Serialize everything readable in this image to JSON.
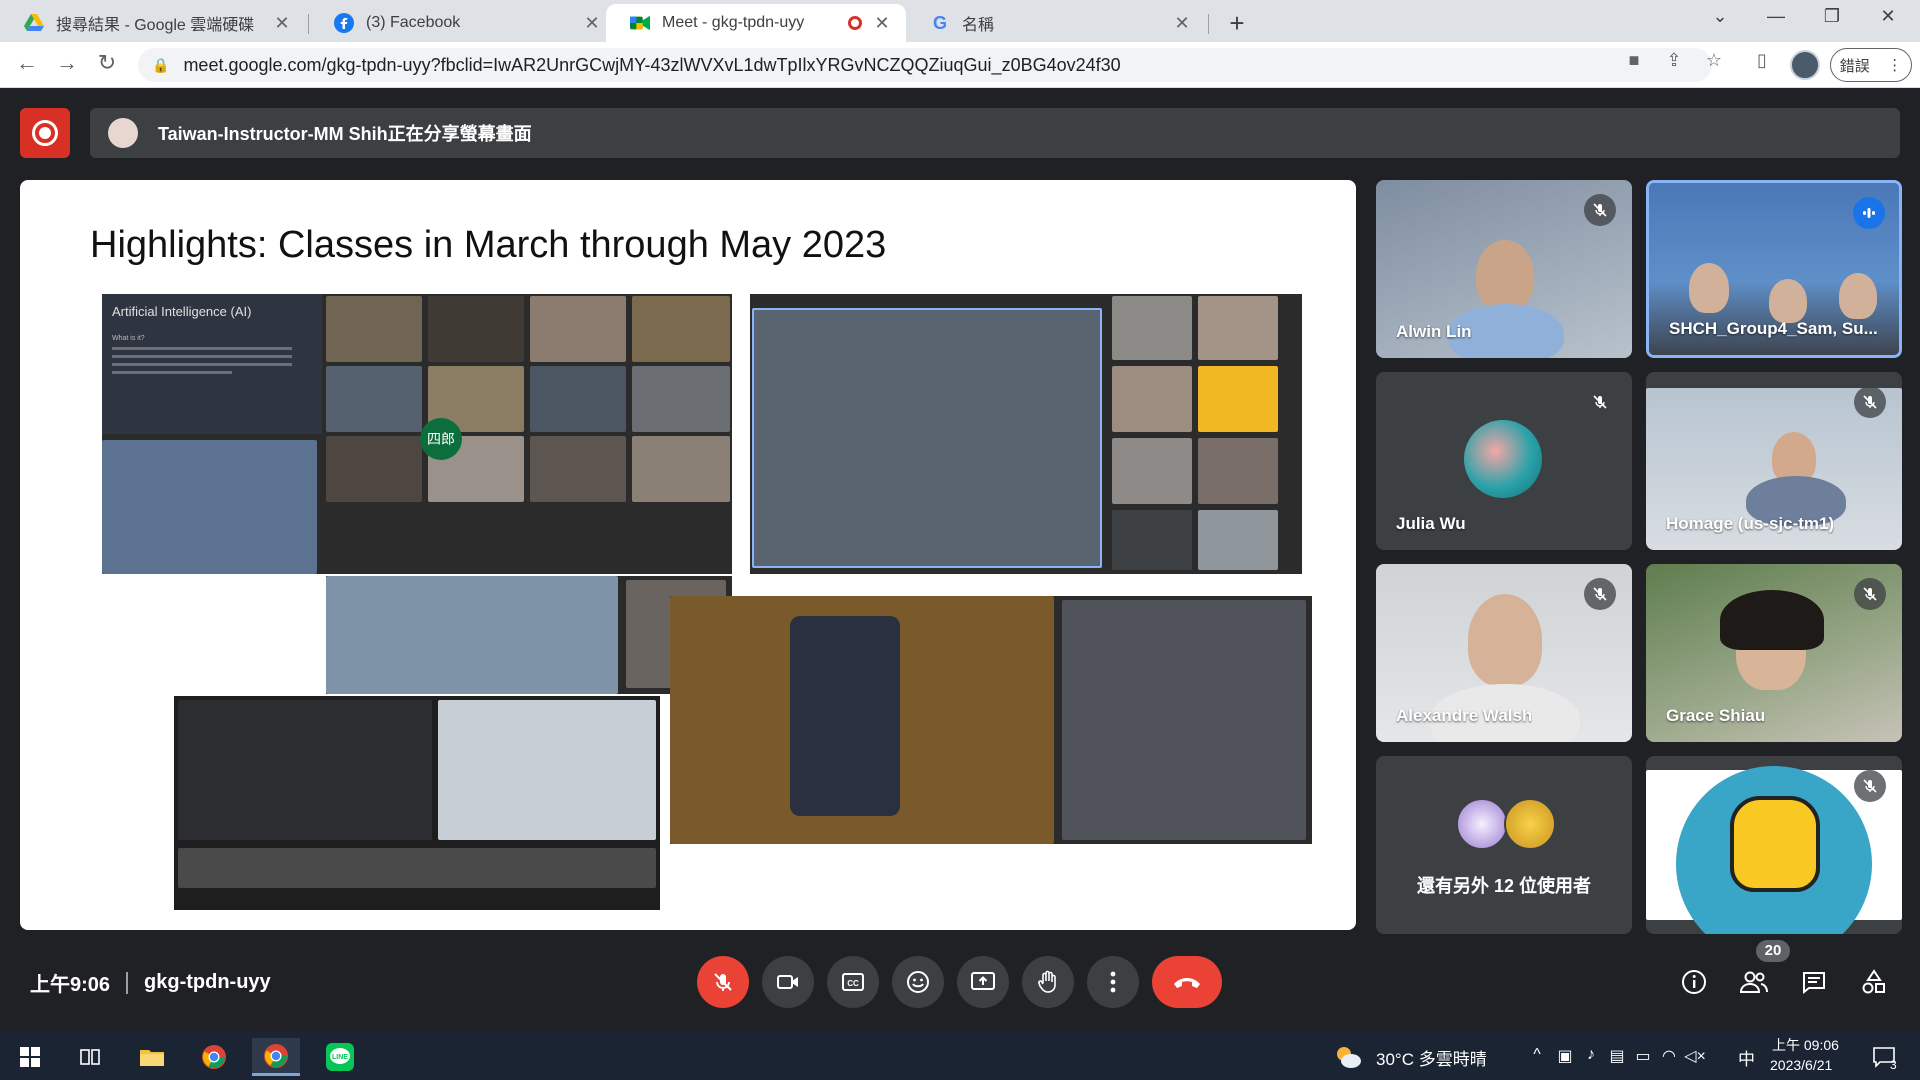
{
  "browser": {
    "tabs": [
      {
        "title": "搜尋結果 - Google 雲端硬碟",
        "close": "✕"
      },
      {
        "title": "(3) Facebook",
        "close": "✕"
      },
      {
        "title": "Meet - gkg-tpdn-uyy",
        "close": "✕"
      },
      {
        "title": "名稱",
        "close": "✕"
      }
    ],
    "new_tab": "+",
    "url": "meet.google.com/gkg-tpdn-uyy?fbclid=IwAR2UnrGCwjMY-43zlWVXvL1dwTpIlxYRGvNCZQQZiuqGui_z0BG4ov24f30",
    "error_button": "錯誤"
  },
  "meet": {
    "presenter_banner": "Taiwan-Instructor-MM Shih正在分享螢幕畫面",
    "slide": {
      "title": "Highlights: Classes in March through May 2023",
      "ai_panel_title": "Artificial Intelligence (AI)",
      "ai_panel_sub": "What is it?",
      "avatar_label": "四郎"
    },
    "participants": [
      {
        "name": "Alwin Lin",
        "muted": true
      },
      {
        "name": "SHCH_Group4_Sam, Su...",
        "speaking": true
      },
      {
        "name": "Julia Wu",
        "muted": true
      },
      {
        "name": "Homage (us-sjc-tm1)",
        "muted": true
      },
      {
        "name": "Alexandre Walsh",
        "muted": true
      },
      {
        "name": "Grace Shiau",
        "muted": true
      },
      {
        "more": "還有另外 12 位使用者"
      },
      {
        "name": "",
        "muted": true
      }
    ],
    "time": "上午9:06",
    "meeting_code": "gkg-tpdn-uyy",
    "participant_count": "20"
  },
  "taskbar": {
    "weather": "30°C  多雲時晴",
    "ime": "中",
    "time": "上午 09:06",
    "date": "2023/6/21",
    "notification_count": "3"
  },
  "colors": {
    "meet_bg": "#202124",
    "tile_bg": "#3c4043",
    "danger": "#ea4335",
    "speaking_border": "#8ab4f8"
  }
}
